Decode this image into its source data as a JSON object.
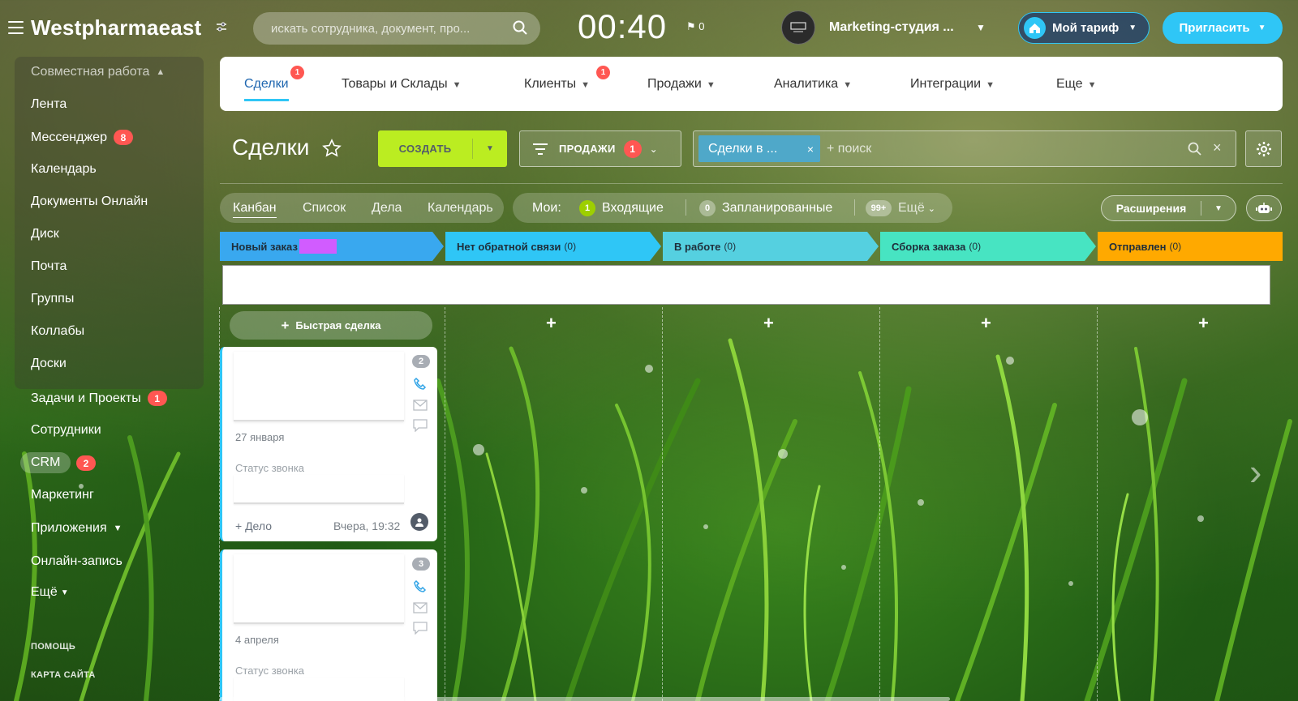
{
  "header": {
    "logo": "Westpharmaeast",
    "search_placeholder": "искать сотрудника, документ, про...",
    "clock": "00:40",
    "flag_count": "0",
    "company_name": "Marketing-студия ...",
    "tariff_label": "Мой тариф",
    "invite_label": "Пригласить"
  },
  "sidebar": {
    "group_title": "Совместная работа",
    "group_items": [
      {
        "label": "Лента"
      },
      {
        "label": "Мессенджер",
        "badge": "8"
      },
      {
        "label": "Календарь"
      },
      {
        "label": "Документы Онлайн"
      },
      {
        "label": "Диск"
      },
      {
        "label": "Почта"
      },
      {
        "label": "Группы"
      },
      {
        "label": "Коллабы"
      },
      {
        "label": "Доски"
      }
    ],
    "items": [
      {
        "label": "Задачи и Проекты",
        "badge": "1"
      },
      {
        "label": "Сотрудники"
      },
      {
        "label": "CRM",
        "badge": "2"
      },
      {
        "label": "Маркетинг"
      },
      {
        "label": "Приложения"
      },
      {
        "label": "Онлайн-запись"
      },
      {
        "label": "Ещё"
      }
    ],
    "help": "ПОМОЩЬ",
    "sitemap": "КАРТА САЙТА"
  },
  "module_nav": {
    "tabs": [
      {
        "label": "Сделки",
        "counter": "1"
      },
      {
        "label": "Товары и Склады"
      },
      {
        "label": "Клиенты",
        "counter": "1"
      },
      {
        "label": "Продажи"
      },
      {
        "label": "Аналитика"
      },
      {
        "label": "Интеграции"
      },
      {
        "label": "Еще"
      }
    ]
  },
  "toolbar": {
    "title": "Сделки",
    "create_label": "СОЗДАТЬ",
    "funnel_label": "ПРОДАЖИ",
    "funnel_counter": "1",
    "filter_chip": "Сделки в ...",
    "filter_placeholder": "+ поиск"
  },
  "views": {
    "items": [
      "Канбан",
      "Список",
      "Дела",
      "Календарь"
    ],
    "counters_label": "Мои:",
    "incoming_count": "1",
    "incoming_label": "Входящие",
    "planned_count": "0",
    "planned_label": "Запланированные",
    "more_count": "99+",
    "more_label": "Ещё",
    "extensions_label": "Расширения"
  },
  "kanban": {
    "stages": [
      {
        "name": "Новый заказ",
        "count": "",
        "color": "#39a8ef"
      },
      {
        "name": "Нет обратной связи",
        "count": "(0)",
        "color": "#2fc6f6"
      },
      {
        "name": "В работе",
        "count": "(0)",
        "color": "#55d0e0"
      },
      {
        "name": "Сборка заказа",
        "count": "(0)",
        "color": "#47e4c2"
      },
      {
        "name": "Отправлен",
        "count": "(0)",
        "color": "#ffa900"
      }
    ],
    "quick_deal": "Быстрая сделка",
    "cards": [
      {
        "num": "2",
        "date": "27 января",
        "status": "Статус звонка",
        "add": "+ Дело",
        "time": "Вчера, 19:32"
      },
      {
        "num": "3",
        "date": "4 апреля",
        "status": "Статус звонка"
      }
    ]
  }
}
